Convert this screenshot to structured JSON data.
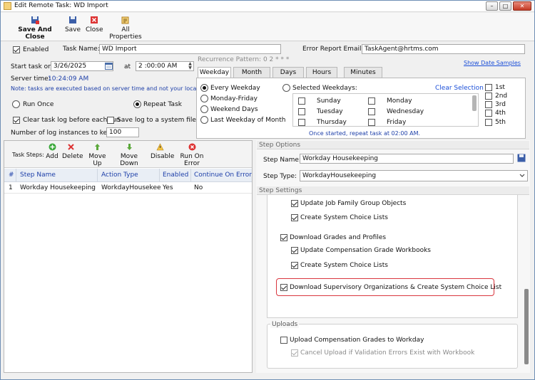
{
  "window": {
    "title": "Edit Remote Task: WD Import"
  },
  "toolbar": {
    "save_and_close": "Save And Close",
    "save": "Save",
    "close": "Close",
    "all_properties": "All Properties"
  },
  "task": {
    "enabled_label": "Enabled",
    "enabled": true,
    "task_name_label": "Task Name:",
    "task_name": "WD Import",
    "error_email_label": "Error Report Email:",
    "error_email": "TaskAgent@hrtms.com",
    "start_label": "Start task on",
    "start_date": "3/26/2025",
    "at_label": "at",
    "start_time": "2 :00:00 AM",
    "server_time_label": "Server time:",
    "server_time": "10:24:09 AM",
    "note": "Note: tasks are executed based on server time and not your local time!",
    "run_once": "Run Once",
    "repeat_task": "Repeat Task",
    "clear_log": "Clear task log before each run",
    "save_log": "Save log to a system file",
    "log_instances_label": "Number of log instances to keep:",
    "log_instances": "100"
  },
  "recurrence": {
    "pattern_label": "Recurrence Pattern: 0 2 * * *",
    "show_samples": "Show Date Samples",
    "tabs": [
      "Weekday",
      "Month",
      "Days",
      "Hours",
      "Minutes"
    ],
    "options": [
      "Every Weekday",
      "Monday-Friday",
      "Weekend Days",
      "Last Weekday of Month"
    ],
    "selected_weekdays": "Selected Weekdays:",
    "clear_selection": "Clear Selection",
    "days_left": [
      "Sunday",
      "Tuesday",
      "Thursday"
    ],
    "days_right": [
      "Monday",
      "Wednesday",
      "Friday"
    ],
    "weeks": [
      "1st",
      "2nd",
      "3rd",
      "4th",
      "5th"
    ],
    "summary": "Once started, repeat task at 02:00 AM."
  },
  "steps_toolbar": {
    "label": "Task Steps:",
    "add": "Add",
    "delete": "Delete",
    "move_up": "Move Up",
    "move_down": "Move Down",
    "disable": "Disable",
    "run_on_error": "Run On Error"
  },
  "steps_grid": {
    "columns": [
      "#",
      "Step Name",
      "Action Type",
      "Enabled",
      "Continue On Error"
    ],
    "rows": [
      {
        "num": "1",
        "name": "Workday Housekeeping",
        "action": "WorkdayHousekeepin",
        "enabled": "Yes",
        "continue": "No"
      }
    ]
  },
  "step_options": {
    "header": "Step Options",
    "name_label": "Step Name:",
    "name": "Workday Housekeeping",
    "type_label": "Step Type:",
    "type": "WorkdayHousekeeping"
  },
  "step_settings": {
    "header": "Step Settings",
    "items": [
      "Update Job Family Group Objects",
      "Create System Choice Lists",
      "Download Grades and Profiles",
      "Update Compensation Grade Workbooks",
      "Create System Choice Lists",
      "Download Supervisory Organizations & Create System Choice List"
    ],
    "uploads_header": "Uploads",
    "upload_comp": "Upload Compensation Grades to Workday",
    "cancel_upload": "Cancel Upload if Validation Errors Exist with Workbook"
  },
  "colors": {
    "accent": "#1c3ea8",
    "highlight": "#d9363e"
  }
}
